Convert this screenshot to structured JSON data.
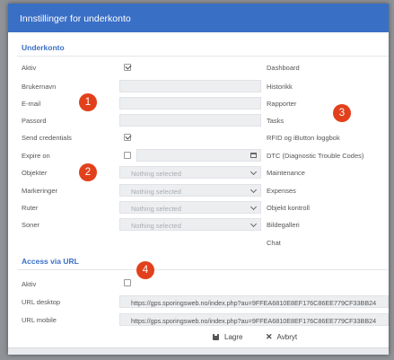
{
  "dialog": {
    "title": "Innstillinger for underkonto"
  },
  "sections": {
    "underkonto": "Underkonto",
    "access": "Access via URL"
  },
  "form": {
    "aktiv_label": "Aktiv",
    "aktiv_checked": true,
    "brukernavn_label": "Brukernavn",
    "brukernavn_value": "",
    "email_label": "E-mail",
    "email_value": "",
    "passord_label": "Passord",
    "passord_value": "",
    "send_credentials_label": "Send credentials",
    "send_credentials_checked": true,
    "expire_on_label": "Expire on",
    "expire_on_checked": false,
    "objekter_label": "Objekter",
    "objekter_value": "Nothing selected",
    "markeringer_label": "Markeringer",
    "markeringer_value": "Nothing selected",
    "ruter_label": "Ruter",
    "ruter_value": "Nothing selected",
    "soner_label": "Soner",
    "soner_value": "Nothing selected"
  },
  "permissions": [
    "Dashboard",
    "Historikk",
    "Rapporter",
    "Tasks",
    "RFID og iButton loggbok",
    "DTC (Diagnostic Trouble Codes)",
    "Maintenance",
    "Expenses",
    "Objekt kontroll",
    "Bildegalleri",
    "Chat"
  ],
  "access": {
    "aktiv_label": "Aktiv",
    "aktiv_checked": false,
    "url_desktop_label": "URL desktop",
    "url_desktop_value": "https://gps.sporingsweb.no/index.php?au=9FFEA6810E8EF176C86EE779CF33BB24",
    "url_mobile_label": "URL mobile",
    "url_mobile_value": "https://gps.sporingsweb.no/index.php?au=9FFEA6810E8EF176C86EE779CF33BB24"
  },
  "buttons": {
    "save": "Lagre",
    "cancel": "Avbryt"
  },
  "annotations": [
    "1",
    "2",
    "3",
    "4"
  ],
  "colors": {
    "accent": "#3a6fc6",
    "badge": "#e2401c"
  }
}
